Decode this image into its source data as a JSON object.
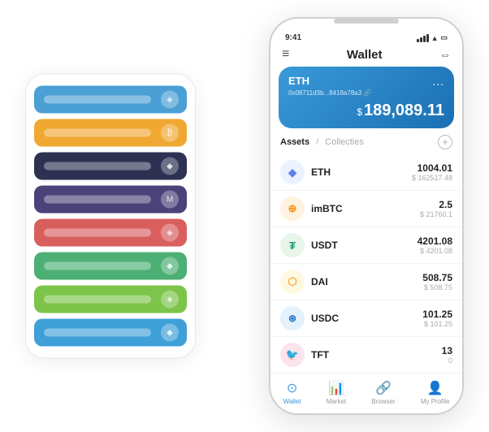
{
  "scene": {
    "card_stack": {
      "items": [
        {
          "color": "si-blue",
          "label": ""
        },
        {
          "color": "si-orange",
          "label": ""
        },
        {
          "color": "si-dark",
          "label": ""
        },
        {
          "color": "si-purple",
          "label": ""
        },
        {
          "color": "si-red",
          "label": ""
        },
        {
          "color": "si-green",
          "label": ""
        },
        {
          "color": "si-lightgreen",
          "label": ""
        },
        {
          "color": "si-ltblue",
          "label": ""
        }
      ]
    },
    "phone": {
      "status": {
        "time": "9:41",
        "signal": "●●●",
        "wifi": "WiFi",
        "battery": "🔋"
      },
      "header": {
        "menu_icon": "≡",
        "title": "Wallet",
        "expand_icon": "⇔"
      },
      "eth_card": {
        "label": "ETH",
        "more": "...",
        "address": "0x08711d3b...8418a78a3 🔗",
        "currency_symbol": "$",
        "amount": "189,089.11"
      },
      "assets": {
        "tab_active": "Assets",
        "divider": "/",
        "tab_inactive": "Collecties",
        "items": [
          {
            "name": "ETH",
            "icon": "◆",
            "icon_class": "eth-icon",
            "amount_primary": "1004.01",
            "amount_secondary": "$ 162517.48"
          },
          {
            "name": "imBTC",
            "icon": "₿",
            "icon_class": "imbtc-icon",
            "amount_primary": "2.5",
            "amount_secondary": "$ 21760.1"
          },
          {
            "name": "USDT",
            "icon": "₮",
            "icon_class": "usdt-icon",
            "amount_primary": "4201.08",
            "amount_secondary": "$ 4201.08"
          },
          {
            "name": "DAI",
            "icon": "◈",
            "icon_class": "dai-icon",
            "amount_primary": "508.75",
            "amount_secondary": "$ 508.75"
          },
          {
            "name": "USDC",
            "icon": "$",
            "icon_class": "usdc-icon",
            "amount_primary": "101.25",
            "amount_secondary": "$ 101.25"
          },
          {
            "name": "TFT",
            "icon": "🐦",
            "icon_class": "tft-icon",
            "amount_primary": "13",
            "amount_secondary": "0"
          }
        ]
      },
      "nav": {
        "items": [
          {
            "label": "Wallet",
            "icon": "⊙",
            "active": true
          },
          {
            "label": "Market",
            "icon": "📈",
            "active": false
          },
          {
            "label": "Browser",
            "icon": "👥",
            "active": false
          },
          {
            "label": "My Profile",
            "icon": "👤",
            "active": false
          }
        ]
      }
    }
  }
}
